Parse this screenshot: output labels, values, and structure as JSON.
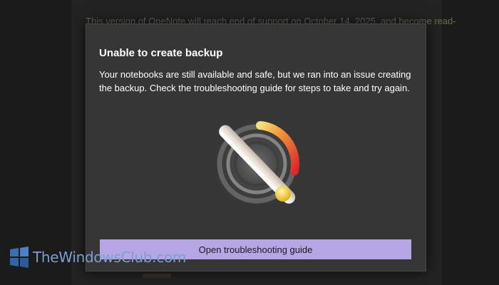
{
  "background": {
    "banner_text": "This version of OneNote will reach end of support on October 14, 2025, and become read-only"
  },
  "dialog": {
    "title": "Unable to create backup",
    "message": "Your notebooks are still available and safe, but we ran into an issue creating the backup. Check the troubleshooting guide for steps to take and try again.",
    "illustration_icon": "failed-backup-illustration",
    "primary_button_label": "Open troubleshooting guide",
    "accent_color": "#b7a6e6"
  },
  "watermark": {
    "text": "TheWindowsClub.com",
    "logo_icon": "thewindowsclub-logo-icon"
  }
}
